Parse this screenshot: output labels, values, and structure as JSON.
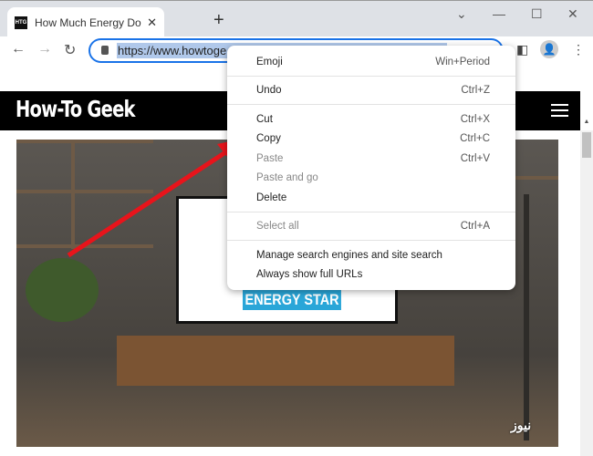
{
  "browser": {
    "tab_title": "How Much Energy Does Energy Star",
    "favicon": "HTG",
    "new_tab": "+",
    "url": "https://www.howtogeek.com/",
    "url_visible": "https://www.howtoge"
  },
  "site": {
    "logo": "How-To Geek",
    "tv_label": "ENERGY STAR"
  },
  "menu": [
    {
      "label": "Emoji",
      "shortcut": "Win+Period",
      "disabled": false
    },
    {
      "label": "Undo",
      "shortcut": "Ctrl+Z",
      "disabled": false
    },
    {
      "label": "Cut",
      "shortcut": "Ctrl+X",
      "disabled": false
    },
    {
      "label": "Copy",
      "shortcut": "Ctrl+C",
      "disabled": false
    },
    {
      "label": "Paste",
      "shortcut": "Ctrl+V",
      "disabled": true
    },
    {
      "label": "Paste and go",
      "shortcut": "",
      "disabled": true
    },
    {
      "label": "Delete",
      "shortcut": "",
      "disabled": false
    },
    {
      "label": "Select all",
      "shortcut": "Ctrl+A",
      "disabled": true
    },
    {
      "label": "Manage search engines and site search",
      "shortcut": "",
      "disabled": false
    },
    {
      "label": "Always show full URLs",
      "shortcut": "",
      "disabled": false
    }
  ],
  "watermark": "نیوز",
  "colors": {
    "accent": "#1a73e8",
    "arrow": "#e8141b",
    "header": "#000000"
  }
}
